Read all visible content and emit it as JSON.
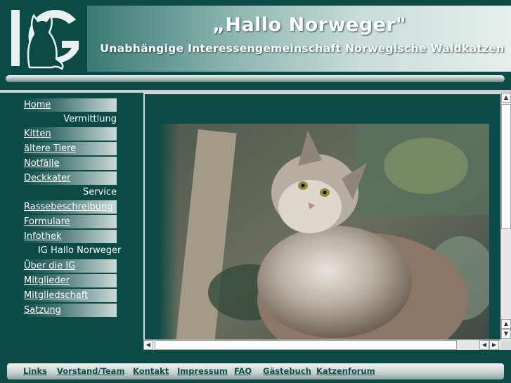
{
  "header": {
    "title": "„Hallo Norweger\"",
    "subtitle": "Unabhängige Interessengemeinschaft Norwegische Waldkatzen",
    "logo_text": "IG"
  },
  "sidebar": {
    "items": [
      {
        "kind": "link",
        "label": "Home"
      },
      {
        "kind": "heading",
        "label": "Vermittlung"
      },
      {
        "kind": "link",
        "label": "Kitten"
      },
      {
        "kind": "link",
        "label": "ältere Tiere"
      },
      {
        "kind": "link",
        "label": "Notfälle"
      },
      {
        "kind": "link",
        "label": "Deckkater"
      },
      {
        "kind": "heading",
        "label": "Service"
      },
      {
        "kind": "link",
        "label": "Rassebeschreibung"
      },
      {
        "kind": "link",
        "label": "Formulare"
      },
      {
        "kind": "link",
        "label": "Infothek"
      },
      {
        "kind": "heading",
        "label": "IG Hallo Norweger"
      },
      {
        "kind": "link",
        "label": "Über die IG"
      },
      {
        "kind": "link",
        "label": "Mitglieder"
      },
      {
        "kind": "link",
        "label": "Mitgliedschaft"
      },
      {
        "kind": "link",
        "label": "Satzung"
      }
    ]
  },
  "content": {
    "image": "norwegian-forest-cat-photo"
  },
  "footer": {
    "links": [
      "Links",
      "Vorstand/Team",
      "Kontakt",
      "Impressum",
      "FAQ",
      "Gästebuch",
      "Katzenforum"
    ]
  },
  "colors": {
    "brand_dark": "#0c4a45",
    "panel_light": "#e6efee"
  }
}
